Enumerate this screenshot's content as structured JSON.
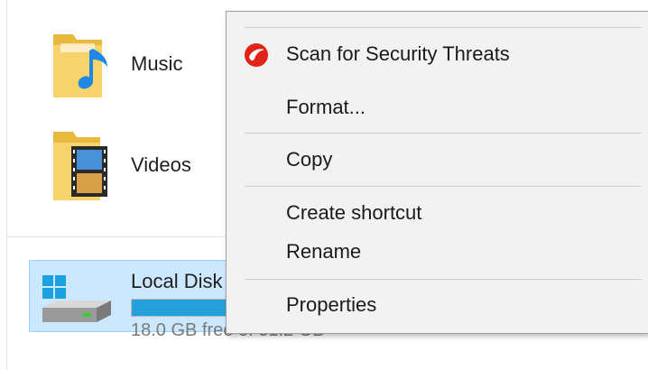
{
  "explorer": {
    "folders": [
      {
        "label": "Music",
        "icon": "music-folder-icon"
      },
      {
        "label": "Videos",
        "icon": "videos-folder-icon"
      }
    ],
    "drive": {
      "name": "Local Disk",
      "free_text": "18.0 GB free of 31.2 GB",
      "used_fraction": 0.42,
      "icon": "hard-drive-icon"
    }
  },
  "context_menu": {
    "items": [
      {
        "label": "Scan for Security Threats",
        "icon": "trend-micro-icon"
      },
      {
        "label": "Format..."
      },
      {
        "label": "Copy"
      },
      {
        "label": "Create shortcut"
      },
      {
        "label": "Rename"
      },
      {
        "label": "Properties"
      }
    ]
  },
  "colors": {
    "selection_bg": "#cce8ff",
    "selection_border": "#99d1ff",
    "menu_bg": "#f2f2f2",
    "drive_bar_fill": "#26a0da",
    "security_icon_red": "#e2231a"
  }
}
